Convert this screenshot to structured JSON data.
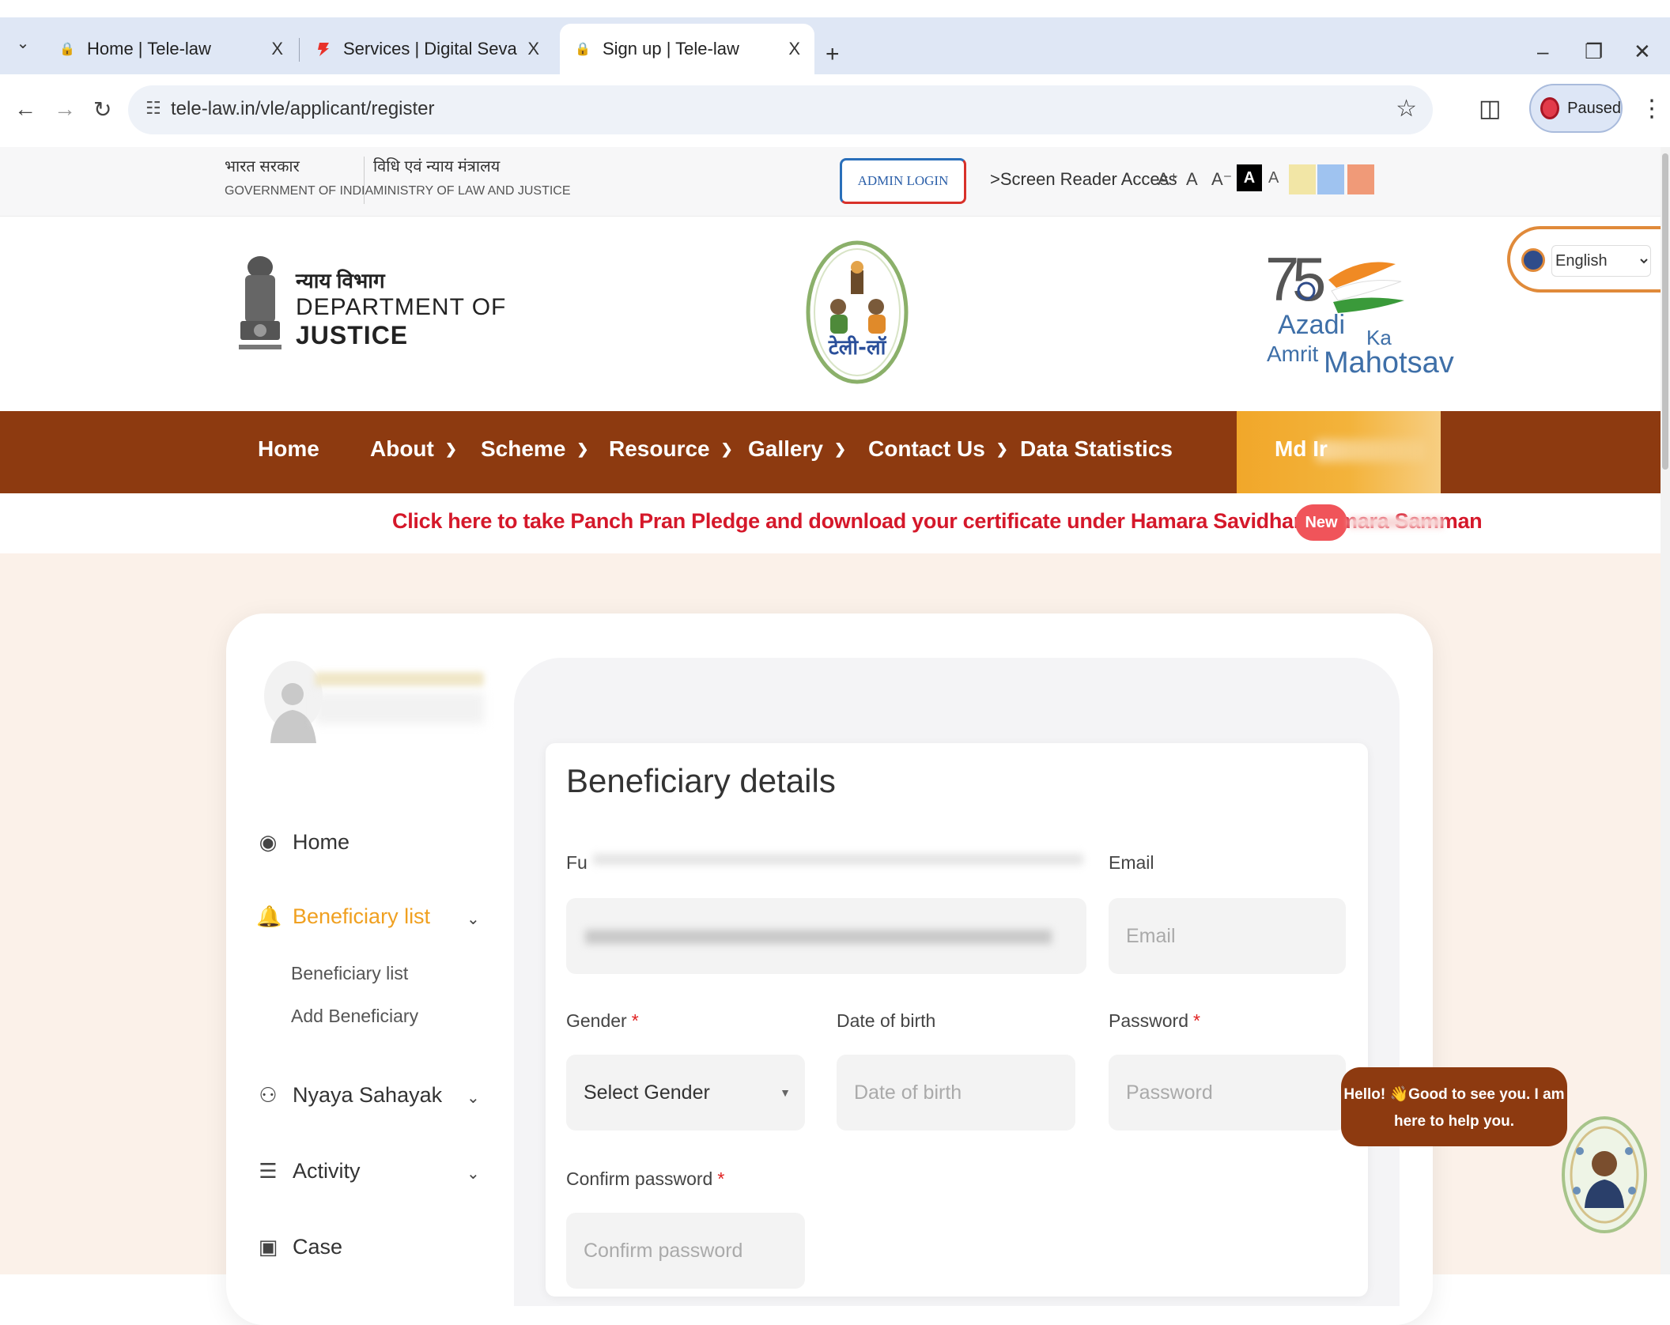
{
  "browser": {
    "tabs": [
      {
        "title": "Home | Tele-law",
        "close": "X"
      },
      {
        "title": "Services | Digital Seva Portal -",
        "close": "X"
      },
      {
        "title": "Sign up | Tele-law",
        "close": "X"
      }
    ],
    "new_tab": "+",
    "url": "tele-law.in/vle/applicant/register",
    "profile_label": "Paused"
  },
  "govstrip": {
    "gov_hi": "भारत सरकार",
    "gov_en": "GOVERNMENT OF INDIA",
    "ministry_hi": "विधि एवं न्याय मंत्रालय",
    "ministry_en": "MINISTRY OF LAW AND JUSTICE",
    "admin_login": "ADMIN LOGIN",
    "screen_reader": ">Screen Reader Access",
    "font_increase": "A⁺",
    "font_normal": "A",
    "font_decrease": "A⁻",
    "contrast_dark": "A",
    "contrast_light": "A",
    "swatches": [
      "#f2e6a6",
      "#9fc3f0",
      "#f09a78"
    ]
  },
  "header": {
    "dept_hi": "न्याय विभाग",
    "dept_en1": "DEPARTMENT OF",
    "dept_en2": "JUSTICE",
    "azadi_1": "Azadi",
    "azadi_ka": "Ka",
    "azadi_amrit": "Amrit",
    "azadi_mahotsav": "Mahotsav",
    "language": "English"
  },
  "nav": {
    "items": [
      {
        "label": "Home",
        "has_dropdown": false
      },
      {
        "label": "About",
        "has_dropdown": true
      },
      {
        "label": "Scheme",
        "has_dropdown": true
      },
      {
        "label": "Resource",
        "has_dropdown": true
      },
      {
        "label": "Gallery",
        "has_dropdown": true
      },
      {
        "label": "Contact Us",
        "has_dropdown": true
      },
      {
        "label": "Data Statistics",
        "has_dropdown": false
      }
    ],
    "user_label": "Md Ir"
  },
  "pledge": {
    "text": "Click here to take Panch Pran Pledge and download your certificate under Hamara Savidhan Hamara Samman",
    "badge": "New"
  },
  "sidebar": {
    "items": [
      {
        "label": "Home",
        "icon": "dashboard-icon"
      },
      {
        "label": "Beneficiary list",
        "icon": "bell-icon",
        "active": true
      },
      {
        "label": "Nyaya Sahayak",
        "icon": "users-icon"
      },
      {
        "label": "Activity",
        "icon": "list-icon"
      },
      {
        "label": "Case",
        "icon": "briefcase-icon"
      }
    ],
    "sub_items": [
      "Beneficiary list",
      "Add Beneficiary"
    ]
  },
  "form": {
    "title": "Beneficiary details",
    "fullname_label": "Fu",
    "email_label": "Email",
    "email_placeholder": "Email",
    "gender_label": "Gender",
    "gender_value": "Select Gender",
    "dob_label": "Date of birth",
    "dob_placeholder": "Date of birth",
    "password_label": "Password",
    "password_placeholder": "Password",
    "confirm_label": "Confirm password",
    "confirm_placeholder": "Confirm password",
    "required_mark": "*"
  },
  "chat": {
    "line1": "Hello! 👋Good to see you. I am",
    "line2": "here to help you."
  }
}
